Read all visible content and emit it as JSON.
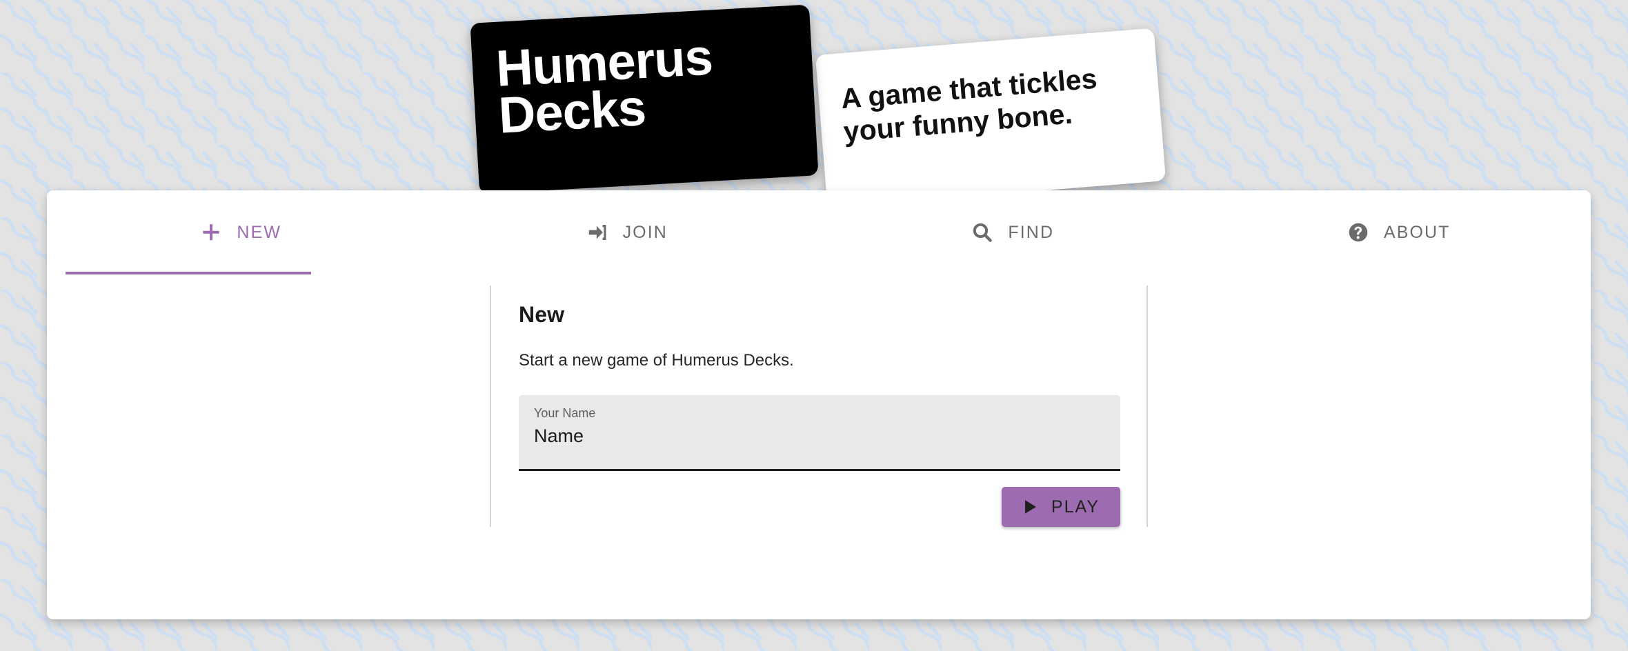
{
  "theme": {
    "background_color": "#e3e3e3",
    "pattern_color": "#cfdff2",
    "accent_purple": "#9c6bb0",
    "panel_color": "#ffffff",
    "text_dark": "#1b1b1b",
    "text_muted": "#6b6b6b",
    "field_background": "#e9e9e9",
    "divider_color": "#d5d5d5"
  },
  "hero": {
    "title": "Humerus\nDecks",
    "tagline": "A game that tickles\nyour funny bone."
  },
  "tabs": [
    {
      "id": "new",
      "label": "NEW",
      "icon": "plus-icon",
      "active": true
    },
    {
      "id": "join",
      "label": "JOIN",
      "icon": "login-arrow-icon",
      "active": false
    },
    {
      "id": "find",
      "label": "FIND",
      "icon": "search-icon",
      "active": false
    },
    {
      "id": "about",
      "label": "ABOUT",
      "icon": "help-circle-icon",
      "active": false
    }
  ],
  "panel": {
    "title": "New",
    "description": "Start a new game of Humerus Decks.",
    "name_field": {
      "label": "Your Name",
      "value": "Name",
      "placeholder": "Name"
    },
    "play_button": {
      "label": "PLAY",
      "icon": "play-triangle-icon"
    }
  }
}
